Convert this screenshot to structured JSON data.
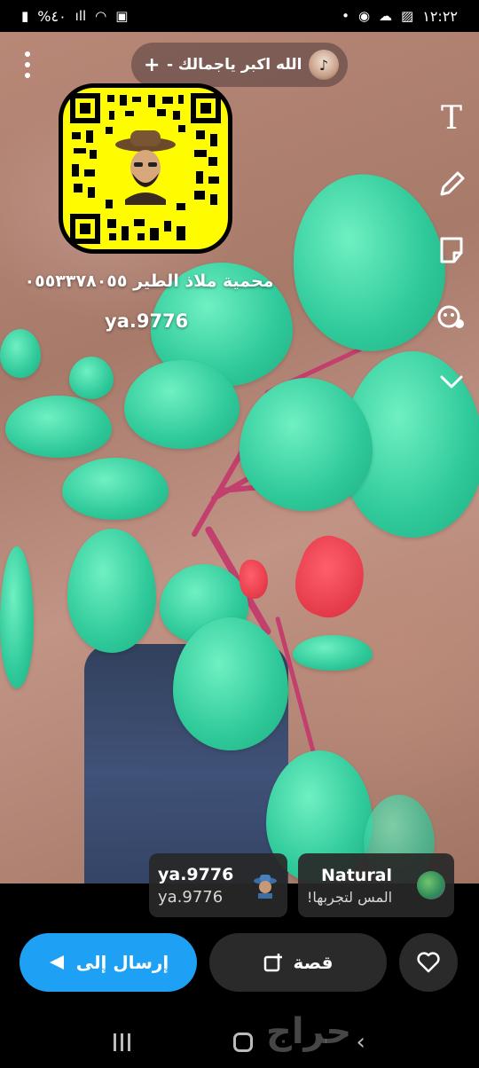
{
  "status_bar": {
    "time": "١٢:٢٢",
    "battery": "%٤٠"
  },
  "sound": {
    "title": "الله اكبر ياجمالك -",
    "add_label": "+"
  },
  "caption": {
    "line1": "محمية ملاذ الطير ٠٥٥٣٣٧٨٠٥٥",
    "line2": "ya.9776"
  },
  "tools": {
    "text_tool": "T"
  },
  "cards": {
    "creator": {
      "title": "ya.9776",
      "subtitle": "ya.9776"
    },
    "lens": {
      "title": "Natural",
      "subtitle": "المس لتجربها!"
    }
  },
  "actions": {
    "send_label": "إرسال إلى",
    "story_label": "قصة"
  },
  "watermark": "حراج",
  "colors": {
    "send_button": "#1ea1f5",
    "snapcode": "#fffc00",
    "leaf": "#2fc99a",
    "stem": "#c23f6e"
  }
}
